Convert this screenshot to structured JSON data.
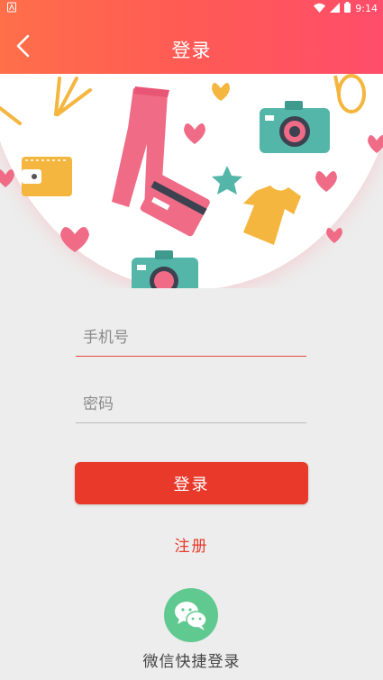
{
  "status_bar": {
    "time": "9:14"
  },
  "header": {
    "title": "登录"
  },
  "form": {
    "phone_placeholder": "手机号",
    "password_placeholder": "密码",
    "login_label": "登录",
    "register_label": "注册"
  },
  "social": {
    "wechat_label": "微信快捷登录",
    "icon": "wechat-icon"
  },
  "colors": {
    "header_start": "#ff6f4a",
    "header_end": "#ff4d6a",
    "accent": "#e8392b",
    "wechat": "#5fc98f",
    "background": "#ededed"
  }
}
